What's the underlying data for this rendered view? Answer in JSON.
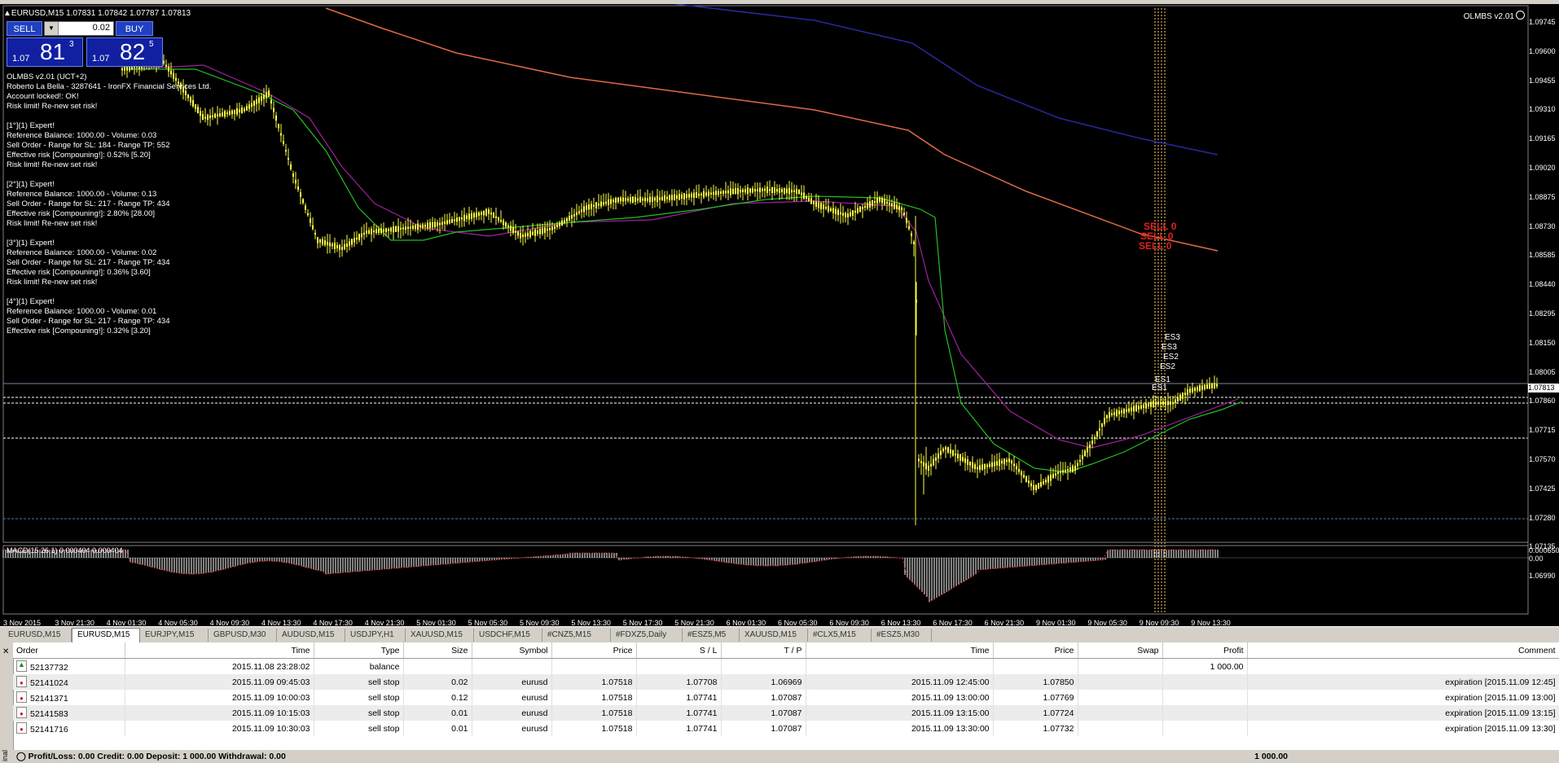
{
  "chart": {
    "symbol_title": "EURUSD,M15  1.07831 1.07842 1.07787 1.07813",
    "ea_label": "OLMBS v2.01",
    "one_click": {
      "sell_label": "SELL",
      "buy_label": "BUY",
      "volume": "0.02",
      "bid_small": "1.07",
      "bid_big": "81",
      "bid_sup": "3",
      "ask_small": "1.07",
      "ask_big": "82",
      "ask_sup": "5"
    },
    "info_lines": [
      "OLMBS v2.01 (UCT+2)",
      "Roberto La Bella - 3287641 - IronFX Financial Services Ltd.",
      "Account locked!: OK!",
      "Risk limit! Re-new set risk!",
      "",
      "[1°](1) Expert!",
      "Reference Balance: 1000.00 - Volume: 0.03",
      "Sell Order - Range for SL: 184 - Range TP: 552",
      "Effective risk [Compouning!]: 0.52% [5.20]",
      "Risk limit! Re-new set risk!",
      "",
      "[2°](1) Expert!",
      "Reference Balance: 1000.00 - Volume: 0.13",
      "Sell Order - Range for SL: 217 - Range TP: 434",
      "Effective risk [Compouning!]: 2.80% [28.00]",
      "Risk limit! Re-new set risk!",
      "",
      "[3°](1) Expert!",
      "Reference Balance: 1000.00 - Volume: 0.02",
      "Sell Order - Range for SL: 217 - Range TP: 434",
      "Effective risk [Compouning!]: 0.36% [3.60]",
      "Risk limit! Re-new set risk!",
      "",
      "[4°](1) Expert!",
      "Reference Balance: 1000.00 - Volume: 0.01",
      "Sell Order - Range for SL: 217 - Range TP: 434",
      "Effective risk [Compouning!]: 0.32% [3.20]"
    ],
    "price_axis": [
      "1.09745",
      "1.09600",
      "1.09455",
      "1.09310",
      "1.09165",
      "1.09020",
      "1.08875",
      "1.08730",
      "1.08585",
      "1.08440",
      "1.08295",
      "1.08150",
      "1.08005",
      "1.07860",
      "1.07715",
      "1.07570",
      "1.07425",
      "1.07280",
      "1.07135",
      "1.06990"
    ],
    "current_price": "1.07813",
    "macd_label": "MACD(15,26,1) 0.000404 0.000404",
    "macd_axis": [
      "0.000650",
      "0.00"
    ],
    "time_axis": [
      "3 Nov 2015",
      "3 Nov 21:30",
      "4 Nov 01:30",
      "4 Nov 05:30",
      "4 Nov 09:30",
      "4 Nov 13:30",
      "4 Nov 17:30",
      "4 Nov 21:30",
      "5 Nov 01:30",
      "5 Nov 05:30",
      "5 Nov 09:30",
      "5 Nov 13:30",
      "5 Nov 17:30",
      "5 Nov 21:30",
      "6 Nov 01:30",
      "6 Nov 05:30",
      "6 Nov 09:30",
      "6 Nov 13:30",
      "6 Nov 17:30",
      "6 Nov 21:30",
      "9 Nov 01:30",
      "9 Nov 05:30",
      "9 Nov 09:30",
      "9 Nov 13:30"
    ],
    "red_objects": [
      "SELL 0",
      "SELL 0",
      "SELL 0"
    ],
    "white_objects": [
      "ES3",
      "ES3",
      "ES2",
      "ES2",
      "ES1",
      "ES1"
    ],
    "colors": {
      "candles": "#ffff40",
      "ma_fast": "#22c022",
      "ma_mid": "#a020a0",
      "ma_slow_red": "#e06040",
      "ma_slow_blue": "#2020a0",
      "macd": "#ffffff",
      "macd_signal": "#e02020"
    }
  },
  "tabs": [
    "EURUSD,M15",
    "EURUSD,M15",
    "EURJPY,M15",
    "GBPUSD,M30",
    "AUDUSD,M15",
    "USDJPY,H1",
    "XAUUSD,M15",
    "USDCHF,M15",
    "#CNZ5,M15",
    "#FDXZ5,Daily",
    "#ESZ5,M5",
    "XAUUSD,M15",
    "#CLX5,M15",
    "#ESZ5,M30"
  ],
  "active_tab_index": 1,
  "terminal": {
    "side_label": "inal",
    "headers": [
      "Order",
      "Time",
      "Type",
      "Size",
      "Symbol",
      "Price",
      "S / L",
      "T / P",
      "Time",
      "Price",
      "Swap",
      "Profit",
      "Comment"
    ],
    "rows": [
      [
        "52137732",
        "2015.11.08 23:28:02",
        "balance",
        "",
        "",
        "",
        "",
        "",
        "",
        "",
        "",
        "1 000.00",
        ""
      ],
      [
        "52141024",
        "2015.11.09 09:45:03",
        "sell stop",
        "0.02",
        "eurusd",
        "1.07518",
        "1.07708",
        "1.06969",
        "2015.11.09 12:45:00",
        "1.07850",
        "",
        "",
        "expiration [2015.11.09 12:45]"
      ],
      [
        "52141371",
        "2015.11.09 10:00:03",
        "sell stop",
        "0.12",
        "eurusd",
        "1.07518",
        "1.07741",
        "1.07087",
        "2015.11.09 13:00:00",
        "1.07769",
        "",
        "",
        "expiration [2015.11.09 13:00]"
      ],
      [
        "52141583",
        "2015.11.09 10:15:03",
        "sell stop",
        "0.01",
        "eurusd",
        "1.07518",
        "1.07741",
        "1.07087",
        "2015.11.09 13:15:00",
        "1.07724",
        "",
        "",
        "expiration [2015.11.09 13:15]"
      ],
      [
        "52141716",
        "2015.11.09 10:30:03",
        "sell stop",
        "0.01",
        "eurusd",
        "1.07518",
        "1.07741",
        "1.07087",
        "2015.11.09 13:30:00",
        "1.07732",
        "",
        "",
        "expiration [2015.11.09 13:30]"
      ]
    ],
    "summary_text": "Profit/Loss: 0.00  Credit: 0.00  Deposit: 1 000.00  Withdrawal: 0.00",
    "summary_value": "1 000.00"
  }
}
